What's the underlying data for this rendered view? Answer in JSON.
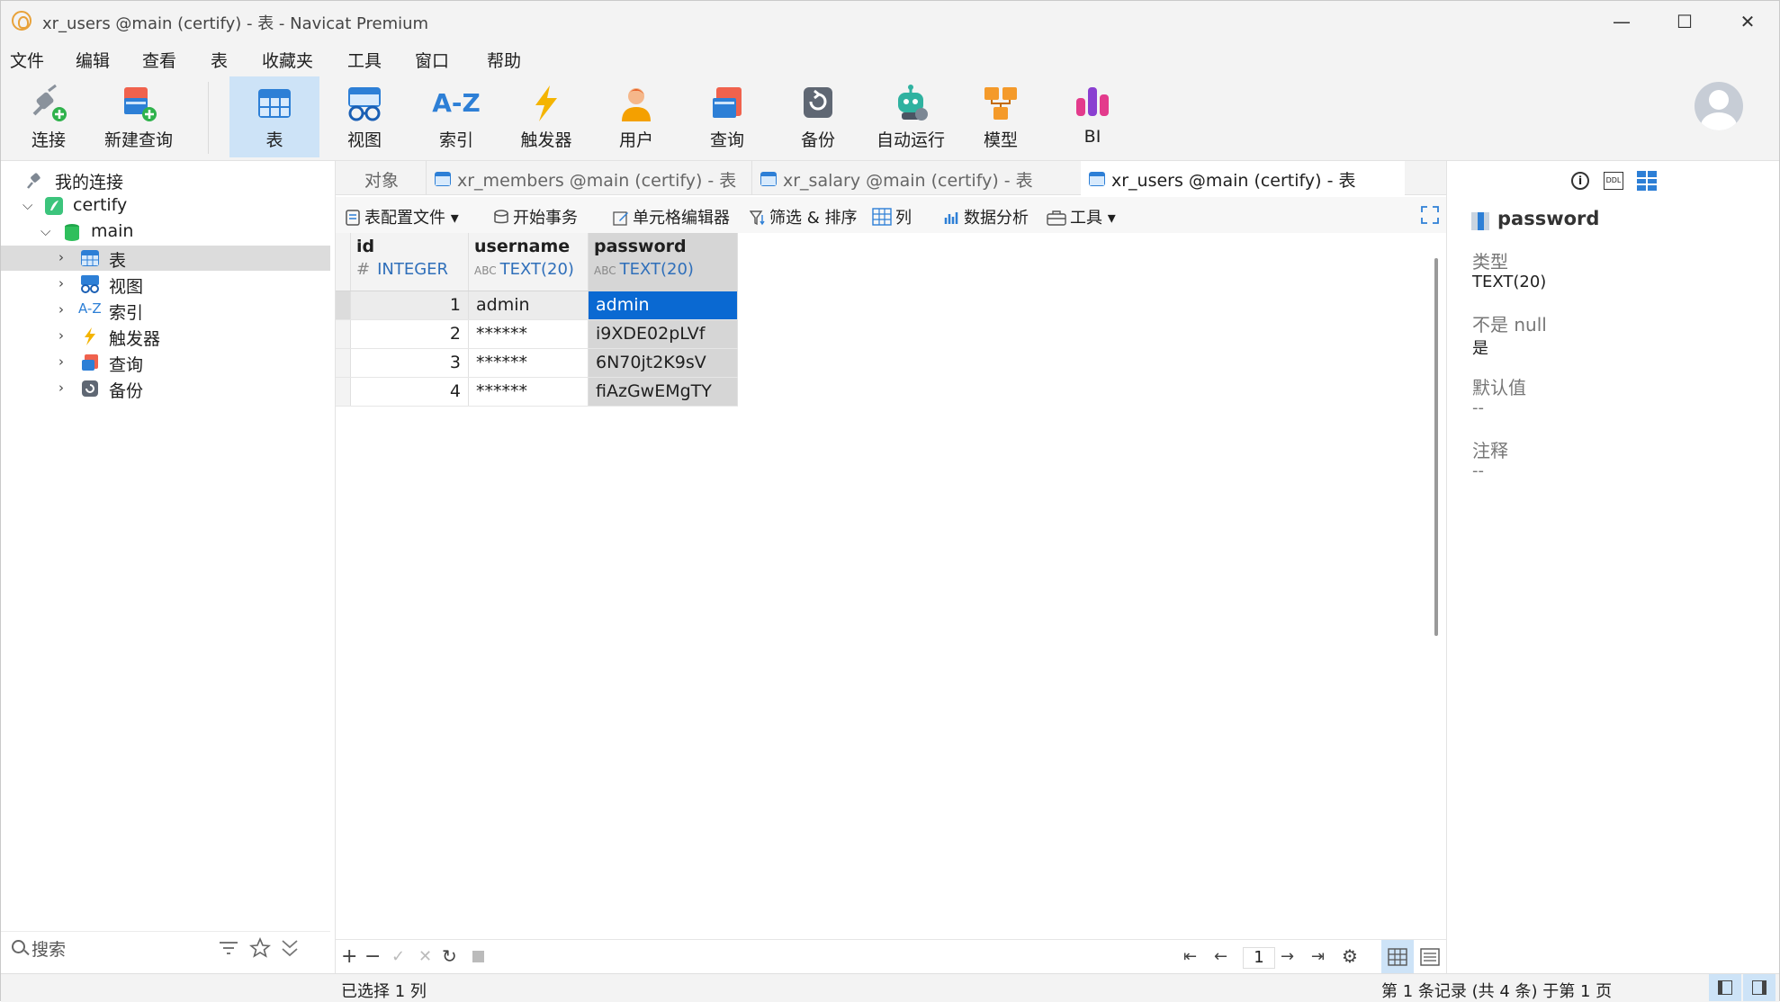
{
  "window": {
    "title": "xr_users @main (certify) - 表 - Navicat Premium",
    "minimize": "—",
    "maximize": "☐",
    "close": "✕"
  },
  "menu": [
    "文件",
    "编辑",
    "查看",
    "表",
    "收藏夹",
    "工具",
    "窗口",
    "帮助"
  ],
  "toolbar": {
    "connect": "连接",
    "new_query": "新建查询",
    "table": "表",
    "view": "视图",
    "index": "索引",
    "trigger": "触发器",
    "user": "用户",
    "query": "查询",
    "backup": "备份",
    "automation": "自动运行",
    "model": "模型",
    "bi": "BI",
    "index_icon_text": "A-Z"
  },
  "navigator": {
    "my_connections": "我的连接",
    "connection": "certify",
    "database": "main",
    "items": {
      "tables": "表",
      "views": "视图",
      "indexes": "索引",
      "triggers": "触发器",
      "queries": "查询",
      "backups": "备份"
    },
    "index_icon_text": "A-Z",
    "search_placeholder": "搜索"
  },
  "tabs": {
    "objects": "对象",
    "tab1": "xr_members @main (certify) - 表",
    "tab2": "xr_salary @main (certify) - 表",
    "tab3": "xr_users @main (certify) - 表"
  },
  "subtoolbar": {
    "table_profile": "表配置文件",
    "begin_transaction": "开始事务",
    "cell_editor": "单元格编辑器",
    "filter_sort": "筛选 & 排序",
    "columns": "列",
    "data_analysis": "数据分析",
    "tools": "工具"
  },
  "grid": {
    "columns": [
      {
        "name": "id",
        "type": "INTEGER",
        "type_icon": "#"
      },
      {
        "name": "username",
        "type": "TEXT(20)",
        "type_icon": "ABC"
      },
      {
        "name": "password",
        "type": "TEXT(20)",
        "type_icon": "ABC"
      }
    ],
    "rows": [
      {
        "id": "1",
        "username": "admin",
        "password": "admin"
      },
      {
        "id": "2",
        "username": "******",
        "password": "i9XDE02pLVf"
      },
      {
        "id": "3",
        "username": "******",
        "password": "6N70jt2K9sV"
      },
      {
        "id": "4",
        "username": "******",
        "password": "fiAzGwEMgTY"
      }
    ]
  },
  "pager": {
    "page": "1"
  },
  "inspector": {
    "field": "password",
    "type_label": "类型",
    "type_value": "TEXT(20)",
    "notnull_label": "不是 null",
    "notnull_value": "是",
    "default_label": "默认值",
    "default_value": "--",
    "comment_label": "注释",
    "comment_value": "--",
    "ddl_icon_text": "DDL"
  },
  "status": {
    "left": "已选择 1 列",
    "right": "第 1 条记录 (共 4 条) 于第 1 页"
  },
  "colors": {
    "accent": "#0a69d2",
    "selected_toolbar": "#cde3f7",
    "column_selection": "#d6d6d6"
  }
}
